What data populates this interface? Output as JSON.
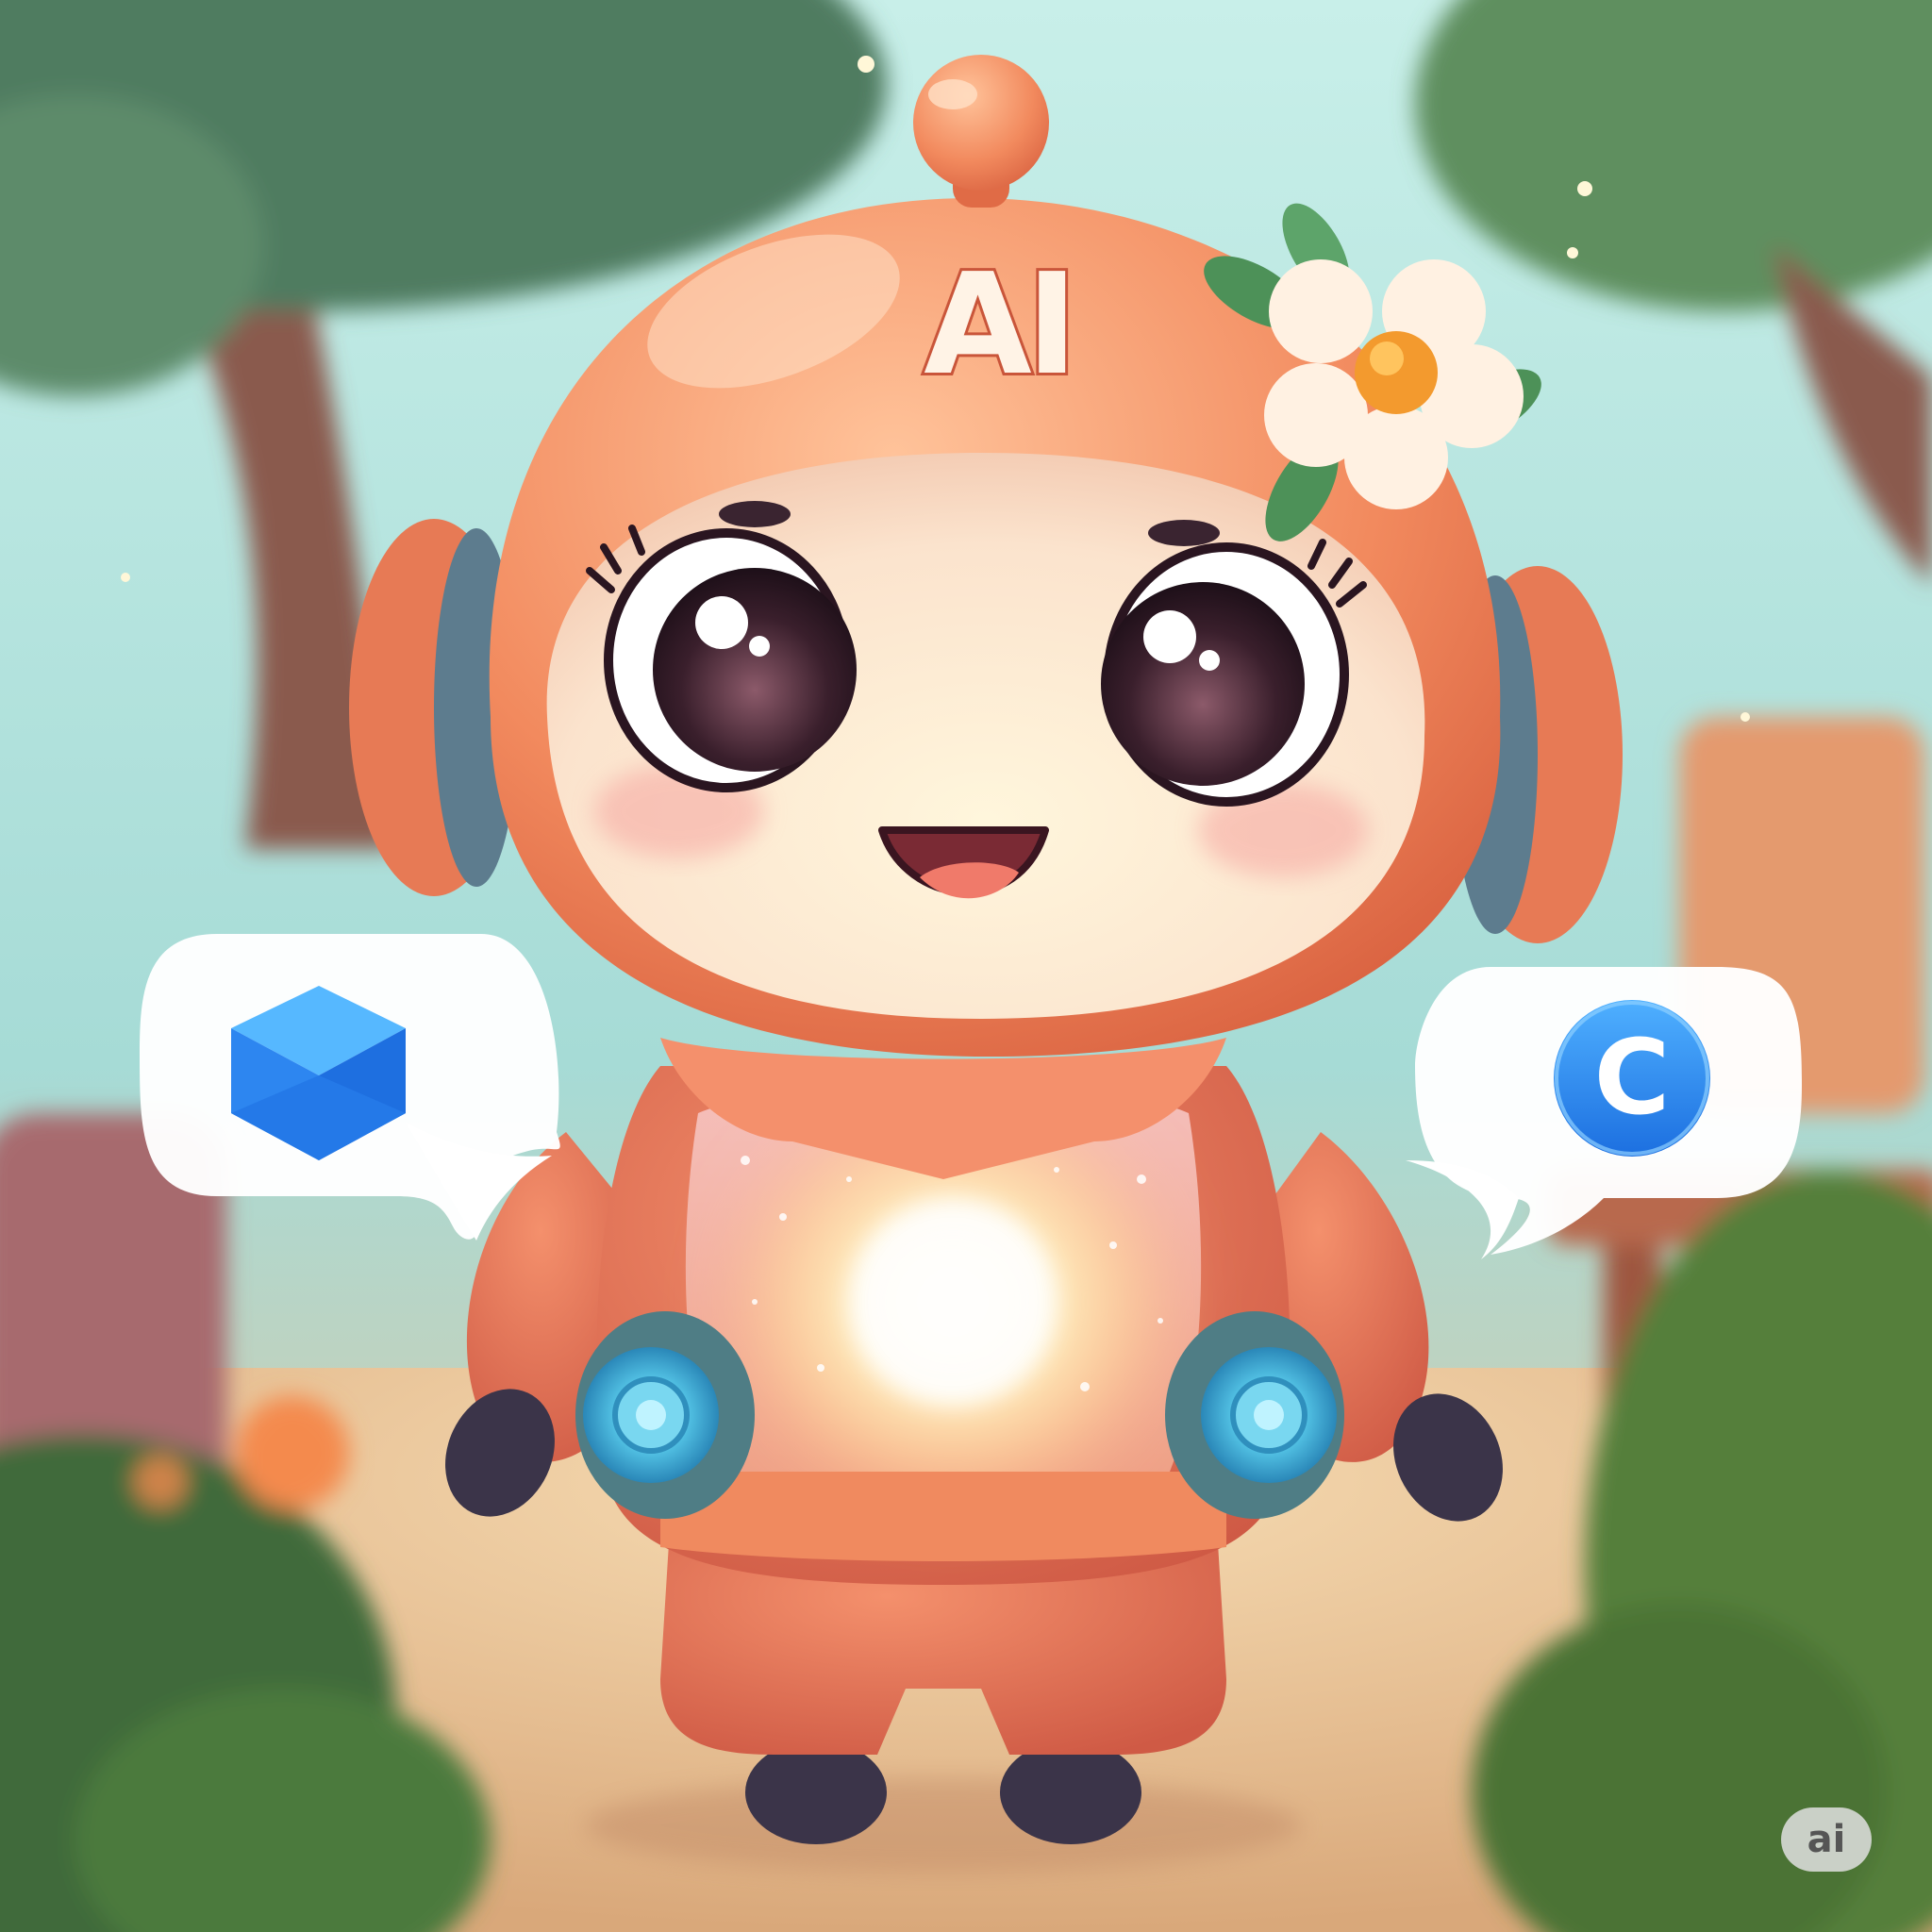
{
  "helmet": {
    "label": "AI"
  },
  "bubbles": {
    "left": {
      "icon": "envelope-icon",
      "color": "#2f8cf0"
    },
    "right": {
      "icon": "c-circle-icon",
      "color": "#2f8cf0",
      "glyph": "C"
    }
  },
  "watermark": {
    "label": "ai"
  },
  "colors": {
    "sky": "#a9e3dc",
    "helmet": "#f08a5f",
    "suit": "#e8715a",
    "face": "#fbe7d3",
    "core_glow": "#fff6c8",
    "accent_blue": "#56c7e8"
  }
}
